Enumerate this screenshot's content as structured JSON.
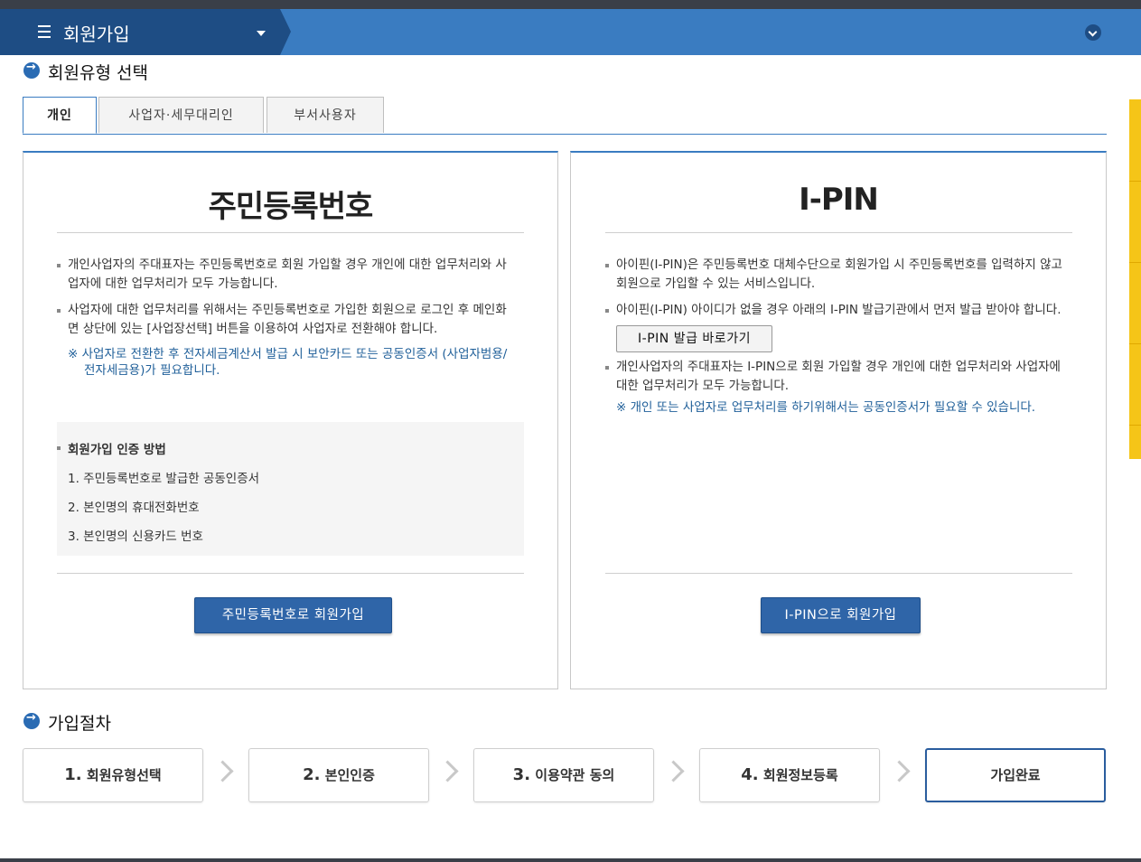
{
  "header": {
    "menu_title": "회원가입"
  },
  "section_member_type": {
    "title": "회원유형 선택"
  },
  "tabs": [
    {
      "label": "개인",
      "active": true
    },
    {
      "label": "사업자·세무대리인",
      "active": false
    },
    {
      "label": "부서사용자",
      "active": false
    }
  ],
  "panel_rrn": {
    "title": "주민등록번호",
    "bullets": [
      "개인사업자의 주대표자는 주민등록번호로 회원 가입할 경우 개인에 대한 업무처리와 사업자에 대한 업무처리가 모두 가능합니다.",
      "사업자에 대한 업무처리를 위해서는 주민등록번호로 가입한 회원으로 로그인 후 메인화면 상단에 있는 [사업장선택] 버튼을 이용하여 사업자로 전환해야 합니다."
    ],
    "note": "※ 사업자로 전환한 후 전자세금계산서 발급 시 보안카드 또는 공동인증서 (사업자범용/전자세금용)가 필요합니다.",
    "methods_title": "회원가입 인증 방법",
    "methods": [
      "1. 주민등록번호로 발급한 공동인증서",
      "2. 본인명의 휴대전화번호",
      "3. 본인명의 신용카드 번호"
    ],
    "button": "주민등록번호로 회원가입"
  },
  "panel_ipin": {
    "title": "I-PIN",
    "bullet1": "아이핀(I-PIN)은 주민등록번호 대체수단으로 회원가입 시 주민등록번호를 입력하지 않고 회원으로 가입할 수 있는 서비스입니다.",
    "bullet2": "아이핀(I-PIN) 아이디가 없을 경우 아래의 I-PIN 발급기관에서 먼저 발급 받아야 합니다.",
    "issue_button": "I-PIN 발급 바로가기",
    "bullet3": "개인사업자의 주대표자는 I-PIN으로 회원 가입할 경우 개인에 대한 업무처리와 사업자에 대한 업무처리가 모두 가능합니다.",
    "note": "※ 개인 또는 사업자로 업무처리를 하기위해서는 공동인증서가 필요할 수 있습니다.",
    "button": "I-PIN으로 회원가입"
  },
  "section_steps": {
    "title": "가입절차"
  },
  "steps": [
    {
      "num": "1.",
      "label": "회원유형선택"
    },
    {
      "num": "2.",
      "label": "본인인증"
    },
    {
      "num": "3.",
      "label": "이용약관 동의"
    },
    {
      "num": "4.",
      "label": "회원정보등록"
    },
    {
      "num": "",
      "label": "가입완료"
    }
  ]
}
